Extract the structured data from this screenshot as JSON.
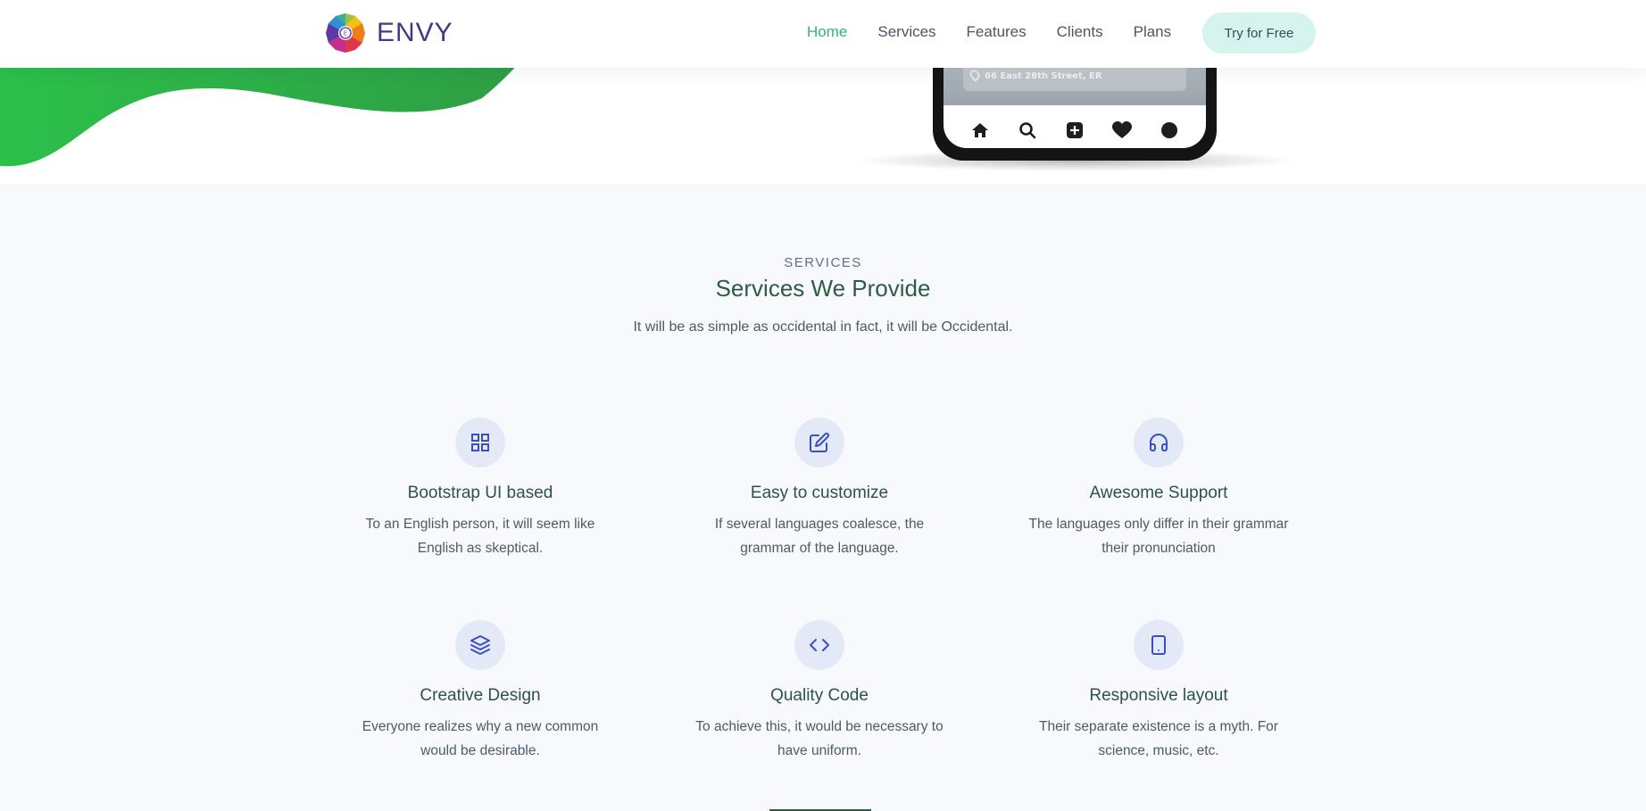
{
  "navbar": {
    "brand": "ENVY",
    "nav_items": [
      "Home",
      "Services",
      "Features",
      "Clients",
      "Plans"
    ],
    "active_item": "Home",
    "cta_label": "Try for Free"
  },
  "hero": {
    "phone_address": "66 East 28th Street, ER"
  },
  "services": {
    "eyebrow": "SERVICES",
    "title": "Services We Provide",
    "subtitle": "It will be as simple as occidental in fact, it will be Occidental.",
    "items": [
      {
        "title": "Bootstrap UI based",
        "desc": "To an English person, it will seem like English as skeptical.",
        "icon": "grid-icon"
      },
      {
        "title": "Easy to customize",
        "desc": "If several languages coalesce, the grammar of the language.",
        "icon": "edit-icon"
      },
      {
        "title": "Awesome Support",
        "desc": "The languages only differ in their grammar their pronunciation",
        "icon": "headphones-icon"
      },
      {
        "title": "Creative Design",
        "desc": "Everyone realizes why a new common would be desirable.",
        "icon": "layers-icon"
      },
      {
        "title": "Quality Code",
        "desc": "To achieve this, it would be necessary to have uniform.",
        "icon": "code-icon"
      },
      {
        "title": "Responsive layout",
        "desc": "Their separate existence is a myth. For science, music, etc.",
        "icon": "tablet-icon"
      }
    ]
  },
  "colors": {
    "accent_green": "#2fb577",
    "icon_blue": "#3b4fc4",
    "icon_bg": "#e4e9f8",
    "cta_bg": "#d5f4ee",
    "wave_green": "#2eaa4a"
  }
}
